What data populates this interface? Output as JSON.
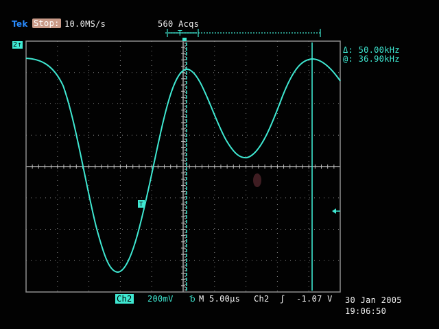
{
  "header": {
    "brand": "Tek",
    "run_state": "Stop:",
    "sample_rate": "10.0MS/s",
    "acquisitions": "560 Acqs"
  },
  "channel": {
    "marker": "2↑",
    "label": "Ch2",
    "volts_per_div": "200mV",
    "bandwidth_icon": "bandwidth-limit-icon"
  },
  "cursor": {
    "delta": "Δ: 50.00kHz",
    "at": "@: 36.90kHz"
  },
  "horizontal": {
    "timebase": "M 5.00µs"
  },
  "trigger": {
    "marker": "T",
    "source": "Ch2",
    "slope_icon": "rising-edge-icon",
    "level": "-1.07 V"
  },
  "timestamp": {
    "date": "30 Jan 2005",
    "time": "19:06:50"
  },
  "colors": {
    "trace": "#3fe8d2",
    "grid": "#9a9a9a",
    "brand": "#2a8cff",
    "stop_badge": "#c99a88"
  }
}
